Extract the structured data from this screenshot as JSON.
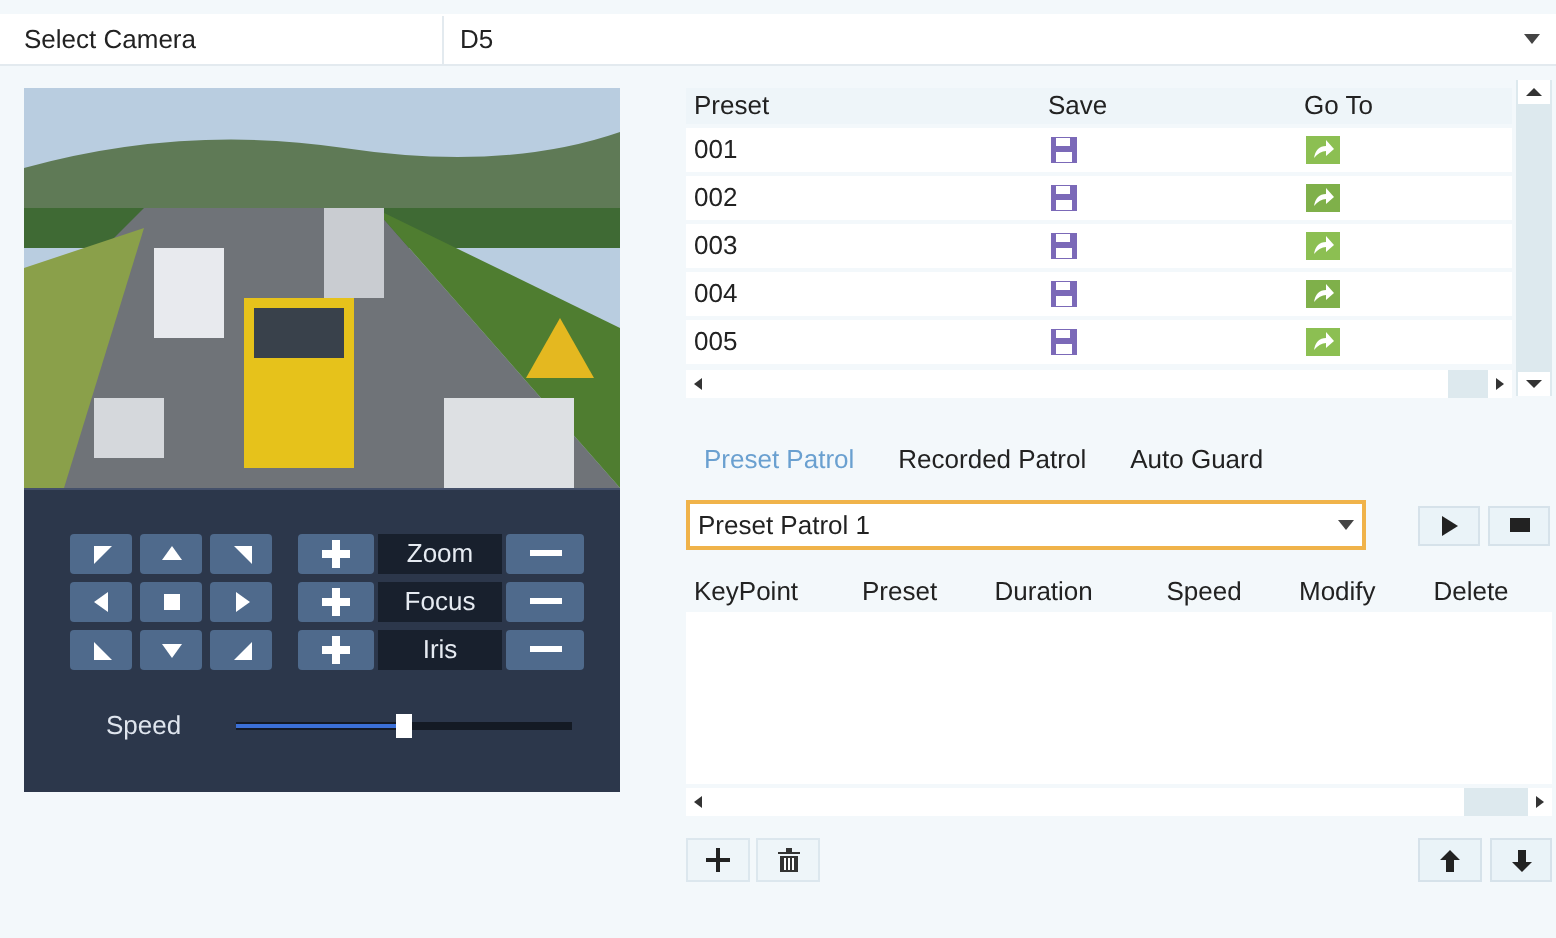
{
  "camera_select": {
    "label": "Select Camera",
    "value": "D5"
  },
  "ptz": {
    "direction_pad": [
      {
        "kind": "up-left"
      },
      {
        "kind": "up"
      },
      {
        "kind": "up-right"
      },
      {
        "kind": "left"
      },
      {
        "kind": "stop"
      },
      {
        "kind": "right"
      },
      {
        "kind": "down-left"
      },
      {
        "kind": "down"
      },
      {
        "kind": "down-right"
      }
    ],
    "lens": [
      {
        "label": "Zoom"
      },
      {
        "label": "Focus"
      },
      {
        "label": "Iris"
      }
    ],
    "speed": {
      "label": "Speed",
      "level": 0.5
    }
  },
  "preset_table": {
    "columns": [
      "Preset",
      "Save",
      "Go To"
    ],
    "rows": [
      {
        "preset": "001"
      },
      {
        "preset": "002"
      },
      {
        "preset": "003"
      },
      {
        "preset": "004"
      },
      {
        "preset": "005"
      }
    ]
  },
  "patrol": {
    "tabs": [
      {
        "label": "Preset Patrol",
        "selected": true
      },
      {
        "label": "Recorded Patrol",
        "selected": false
      },
      {
        "label": "Auto Guard",
        "selected": false
      }
    ],
    "dropdown": {
      "value": "Preset Patrol 1"
    },
    "columns": [
      "KeyPoint",
      "Preset",
      "Duration",
      "Speed",
      "Modify",
      "Delete"
    ]
  }
}
